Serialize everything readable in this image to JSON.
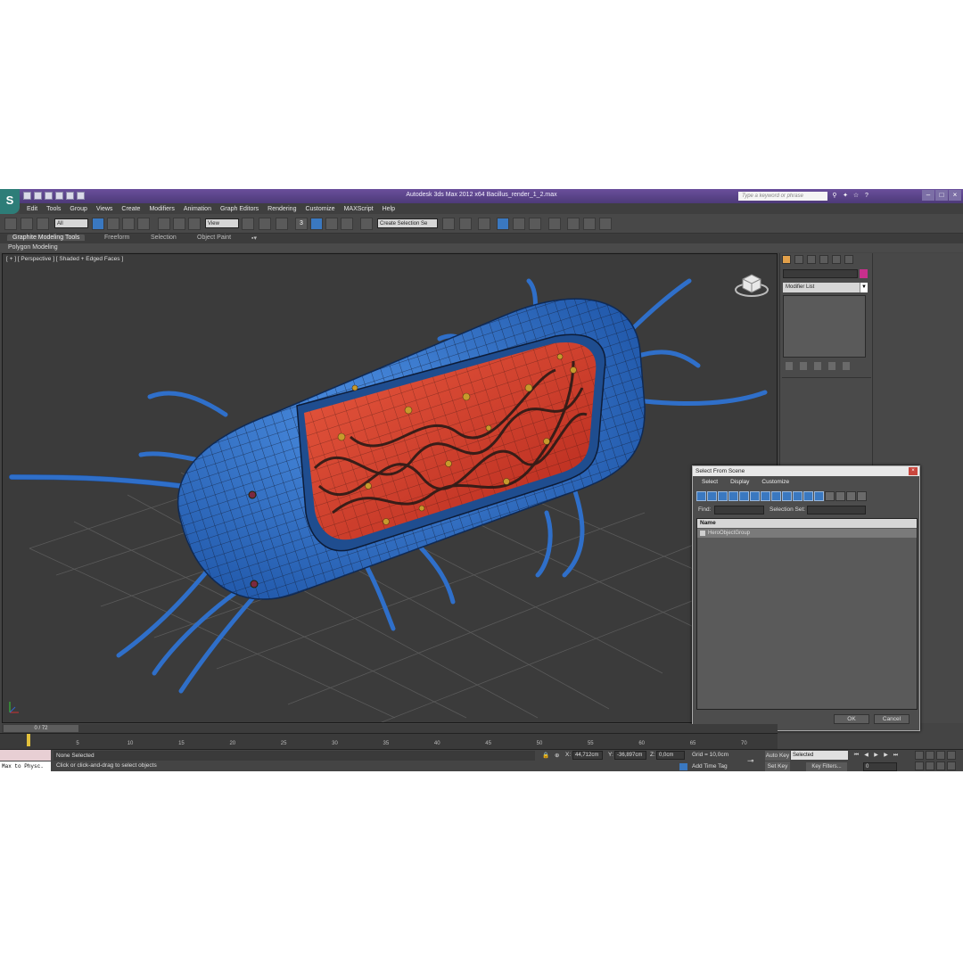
{
  "title_bar": {
    "app_logo": "S",
    "title": "Autodesk 3ds Max  2012 x64      Bacillus_render_1_2.max",
    "search_placeholder": "Type a keyword or phrase"
  },
  "menu": [
    "Edit",
    "Tools",
    "Group",
    "Views",
    "Create",
    "Modifiers",
    "Animation",
    "Graph Editors",
    "Rendering",
    "Customize",
    "MAXScript",
    "Help"
  ],
  "toolbar": {
    "filter": "All",
    "ref_coord": "View",
    "snap_label": "3",
    "named_selection": "Create Selection Se"
  },
  "ribbon": {
    "tabs": [
      "Graphite Modeling Tools",
      "Freeform",
      "Selection",
      "Object Paint"
    ],
    "panel": "Polygon Modeling"
  },
  "viewport": {
    "label": "[ + ] [ Perspective ] [ Shaded + Edged Faces ]",
    "model": "bacillus",
    "shell_color": "#2f6fc9",
    "wire_color": "#14203a",
    "interior_color": "#d8452f"
  },
  "command_panel": {
    "modifier_list": "Modifier List",
    "object_color": "#c82f8c"
  },
  "dialog": {
    "title": "Select From Scene",
    "close": "×",
    "menu": [
      "Select",
      "Display",
      "Customize"
    ],
    "find_label": "Find:",
    "selection_set_label": "Selection Set:",
    "column": "Name",
    "rows": [
      "HeroObjectGroup"
    ],
    "ok": "OK",
    "cancel": "Cancel"
  },
  "timeline": {
    "position": "0 / 72",
    "current_frame": 0,
    "total_frames": 72,
    "ticks": [
      "5",
      "10",
      "15",
      "20",
      "25",
      "30",
      "35",
      "40",
      "45",
      "50",
      "55",
      "60",
      "65",
      "70"
    ]
  },
  "status": {
    "maxscript": "Max to Physc.",
    "selection": "None Selected",
    "hint": "Click or click-and-drag to select objects",
    "x_label": "X:",
    "x_value": "44,712cm",
    "y_label": "Y:",
    "y_value": "-36,897cm",
    "z_label": "Z:",
    "z_value": "0,0cm",
    "grid": "Grid = 10,0cm",
    "add_time_tag": "Add Time Tag",
    "auto_key": "Auto Key",
    "set_key": "Set Key",
    "key_mode": "Selected",
    "key_filters": "Key Filters...",
    "frame": "0"
  }
}
